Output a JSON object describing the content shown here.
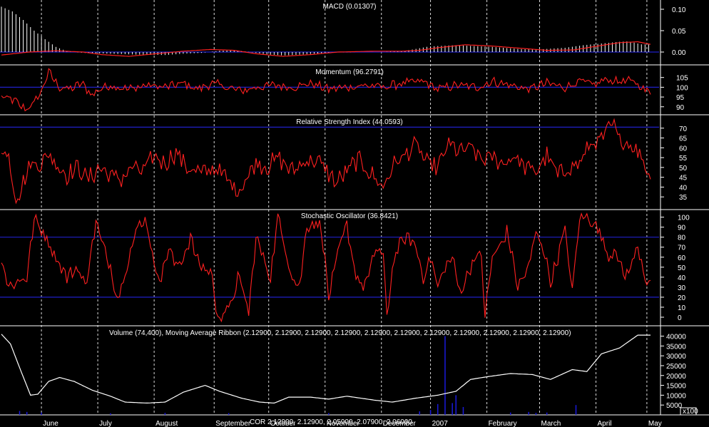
{
  "colors": {
    "background": "#000000",
    "indicator_line": "#ff2020",
    "reference_line": "#2020c8",
    "volume_line": "#ffffff",
    "histogram": "#ffffff",
    "volume_bars": "#1a1adc",
    "month_grid": "#ffffff",
    "text": "#ffffff"
  },
  "ohlc_label": "COR 2.12900, 2.12900, 2.05900, 2.07900, 2.06000",
  "scale_label": "x100",
  "chart_data": [
    {
      "type": "line",
      "panel": "macd",
      "title": "MACD (0.01307)",
      "ylim": [
        -0.015,
        0.115
      ],
      "yticks": [
        "0.10",
        "0.05",
        "0.00"
      ],
      "ytick_values": [
        0.1,
        0.05,
        0.0
      ],
      "reference_lines": [
        0.0
      ],
      "histogram_keys": [
        [
          0,
          0.106
        ],
        [
          6,
          0.095
        ],
        [
          12,
          0.075
        ],
        [
          18,
          0.05
        ],
        [
          24,
          0.03
        ],
        [
          30,
          0.012
        ],
        [
          36,
          0.002
        ],
        [
          45,
          -0.002
        ],
        [
          60,
          -0.004
        ],
        [
          75,
          -0.006
        ],
        [
          90,
          -0.007
        ],
        [
          100,
          -0.004
        ],
        [
          110,
          -0.002
        ],
        [
          120,
          0.003
        ],
        [
          128,
          0.004
        ],
        [
          135,
          0.001
        ],
        [
          145,
          -0.005
        ],
        [
          155,
          -0.008
        ],
        [
          165,
          -0.006
        ],
        [
          175,
          -0.003
        ],
        [
          185,
          -0.001
        ],
        [
          195,
          0.0
        ],
        [
          210,
          0.0
        ],
        [
          220,
          0.002
        ],
        [
          225,
          0.005
        ],
        [
          235,
          0.013
        ],
        [
          250,
          0.016
        ],
        [
          270,
          0.012
        ],
        [
          285,
          0.007
        ],
        [
          295,
          0.006
        ],
        [
          310,
          0.01
        ],
        [
          320,
          0.016
        ],
        [
          330,
          0.02
        ],
        [
          340,
          0.024
        ],
        [
          345,
          0.025
        ],
        [
          352,
          0.018
        ]
      ],
      "signal_keys": [
        [
          0,
          -0.007
        ],
        [
          15,
          0.0
        ],
        [
          30,
          0.003
        ],
        [
          45,
          0.0
        ],
        [
          55,
          -0.006
        ],
        [
          70,
          -0.01
        ],
        [
          85,
          -0.004
        ],
        [
          100,
          0.002
        ],
        [
          115,
          0.006
        ],
        [
          128,
          0.004
        ],
        [
          140,
          -0.004
        ],
        [
          155,
          -0.01
        ],
        [
          170,
          -0.006
        ],
        [
          185,
          0.0
        ],
        [
          205,
          0.002
        ],
        [
          220,
          0.002
        ],
        [
          230,
          0.004
        ],
        [
          240,
          0.01
        ],
        [
          255,
          0.017
        ],
        [
          270,
          0.014
        ],
        [
          285,
          0.009
        ],
        [
          300,
          0.004
        ],
        [
          315,
          0.005
        ],
        [
          325,
          0.012
        ],
        [
          340,
          0.022
        ],
        [
          350,
          0.024
        ],
        [
          357,
          0.018
        ]
      ],
      "n_points": 358
    },
    {
      "type": "line",
      "panel": "momentum",
      "title": "Momentum (96.2791)",
      "ylim": [
        87,
        110
      ],
      "yticks": [
        "105",
        "100",
        "95",
        "90"
      ],
      "ytick_values": [
        105,
        100,
        95,
        90
      ],
      "reference_lines": [
        100
      ],
      "keys": [
        [
          0,
          95
        ],
        [
          8,
          93
        ],
        [
          10,
          90
        ],
        [
          14,
          89
        ],
        [
          18,
          92
        ],
        [
          22,
          98
        ],
        [
          26,
          108
        ],
        [
          28,
          105
        ],
        [
          32,
          100
        ],
        [
          38,
          99
        ],
        [
          44,
          102
        ],
        [
          50,
          96
        ],
        [
          54,
          99
        ],
        [
          60,
          101
        ],
        [
          70,
          99
        ],
        [
          80,
          101
        ],
        [
          90,
          100
        ],
        [
          100,
          102
        ],
        [
          108,
          99
        ],
        [
          116,
          102
        ],
        [
          124,
          100
        ],
        [
          132,
          98
        ],
        [
          140,
          100
        ],
        [
          150,
          101
        ],
        [
          160,
          100
        ],
        [
          170,
          102
        ],
        [
          180,
          99
        ],
        [
          190,
          100
        ],
        [
          200,
          101
        ],
        [
          210,
          100
        ],
        [
          220,
          102
        ],
        [
          232,
          103
        ],
        [
          240,
          99
        ],
        [
          250,
          101
        ],
        [
          262,
          100
        ],
        [
          270,
          103
        ],
        [
          280,
          101
        ],
        [
          290,
          99
        ],
        [
          300,
          102
        ],
        [
          310,
          100
        ],
        [
          318,
          103
        ],
        [
          326,
          101
        ],
        [
          332,
          104
        ],
        [
          340,
          103
        ],
        [
          348,
          103
        ],
        [
          355,
          98
        ],
        [
          357,
          96.3
        ]
      ],
      "noise": 2.0,
      "n_points": 358
    },
    {
      "type": "line",
      "panel": "rsi",
      "title": "Relative Strength Index (44.0593)",
      "ylim": [
        30,
        75
      ],
      "yticks": [
        "70",
        "65",
        "60",
        "55",
        "50",
        "45",
        "40",
        "35"
      ],
      "ytick_values": [
        70,
        65,
        60,
        55,
        50,
        45,
        40,
        35
      ],
      "reference_lines": [
        70.5
      ],
      "keys": [
        [
          0,
          60
        ],
        [
          4,
          55
        ],
        [
          8,
          34
        ],
        [
          12,
          42
        ],
        [
          16,
          52
        ],
        [
          22,
          52
        ],
        [
          26,
          57
        ],
        [
          30,
          52
        ],
        [
          36,
          46
        ],
        [
          42,
          50
        ],
        [
          48,
          44
        ],
        [
          54,
          50
        ],
        [
          60,
          46
        ],
        [
          66,
          44
        ],
        [
          72,
          50
        ],
        [
          78,
          48
        ],
        [
          84,
          56
        ],
        [
          90,
          52
        ],
        [
          96,
          58
        ],
        [
          102,
          50
        ],
        [
          110,
          47
        ],
        [
          118,
          50
        ],
        [
          124,
          44
        ],
        [
          130,
          38
        ],
        [
          136,
          46
        ],
        [
          140,
          53
        ],
        [
          146,
          50
        ],
        [
          152,
          55
        ],
        [
          160,
          48
        ],
        [
          168,
          54
        ],
        [
          176,
          52
        ],
        [
          184,
          42
        ],
        [
          190,
          48
        ],
        [
          196,
          54
        ],
        [
          204,
          46
        ],
        [
          210,
          40
        ],
        [
          216,
          52
        ],
        [
          222,
          56
        ],
        [
          228,
          62
        ],
        [
          234,
          52
        ],
        [
          240,
          50
        ],
        [
          246,
          62
        ],
        [
          252,
          58
        ],
        [
          258,
          60
        ],
        [
          264,
          54
        ],
        [
          270,
          55
        ],
        [
          276,
          52
        ],
        [
          282,
          56
        ],
        [
          288,
          50
        ],
        [
          294,
          48
        ],
        [
          300,
          56
        ],
        [
          306,
          46
        ],
        [
          312,
          50
        ],
        [
          318,
          52
        ],
        [
          324,
          62
        ],
        [
          330,
          64
        ],
        [
          336,
          72
        ],
        [
          340,
          64
        ],
        [
          346,
          62
        ],
        [
          352,
          56
        ],
        [
          357,
          44
        ]
      ],
      "noise": 4.0,
      "n_points": 358
    },
    {
      "type": "line",
      "panel": "stochastic",
      "title": "Stochastic Oscillator (36.8421)",
      "ylim": [
        -5,
        104
      ],
      "yticks": [
        "100",
        "90",
        "80",
        "70",
        "60",
        "50",
        "40",
        "30",
        "20",
        "10",
        "0"
      ],
      "ytick_values": [
        100,
        90,
        80,
        70,
        60,
        50,
        40,
        30,
        20,
        10,
        0
      ],
      "reference_lines": [
        80,
        20
      ],
      "keys": [
        [
          0,
          60
        ],
        [
          4,
          30
        ],
        [
          8,
          35
        ],
        [
          14,
          40
        ],
        [
          18,
          98
        ],
        [
          24,
          82
        ],
        [
          30,
          60
        ],
        [
          36,
          40
        ],
        [
          42,
          50
        ],
        [
          46,
          30
        ],
        [
          52,
          95
        ],
        [
          56,
          70
        ],
        [
          60,
          50
        ],
        [
          64,
          18
        ],
        [
          70,
          60
        ],
        [
          76,
          95
        ],
        [
          80,
          96
        ],
        [
          84,
          50
        ],
        [
          88,
          40
        ],
        [
          92,
          70
        ],
        [
          96,
          50
        ],
        [
          100,
          60
        ],
        [
          104,
          80
        ],
        [
          108,
          55
        ],
        [
          112,
          48
        ],
        [
          116,
          44
        ],
        [
          118,
          2
        ],
        [
          122,
          4
        ],
        [
          126,
          10
        ],
        [
          130,
          40
        ],
        [
          134,
          20
        ],
        [
          136,
          4
        ],
        [
          140,
          80
        ],
        [
          144,
          60
        ],
        [
          148,
          40
        ],
        [
          152,
          100
        ],
        [
          156,
          70
        ],
        [
          160,
          40
        ],
        [
          164,
          30
        ],
        [
          168,
          92
        ],
        [
          172,
          94
        ],
        [
          176,
          90
        ],
        [
          180,
          20
        ],
        [
          186,
          70
        ],
        [
          190,
          92
        ],
        [
          194,
          50
        ],
        [
          198,
          30
        ],
        [
          202,
          40
        ],
        [
          206,
          70
        ],
        [
          210,
          60
        ],
        [
          212,
          2
        ],
        [
          216,
          60
        ],
        [
          220,
          75
        ],
        [
          224,
          80
        ],
        [
          228,
          70
        ],
        [
          232,
          40
        ],
        [
          236,
          60
        ],
        [
          240,
          30
        ],
        [
          244,
          50
        ],
        [
          248,
          60
        ],
        [
          252,
          25
        ],
        [
          256,
          40
        ],
        [
          260,
          60
        ],
        [
          264,
          60
        ],
        [
          266,
          2
        ],
        [
          270,
          60
        ],
        [
          274,
          70
        ],
        [
          278,
          85
        ],
        [
          280,
          70
        ],
        [
          284,
          30
        ],
        [
          290,
          50
        ],
        [
          294,
          85
        ],
        [
          298,
          70
        ],
        [
          302,
          35
        ],
        [
          306,
          60
        ],
        [
          310,
          88
        ],
        [
          314,
          25
        ],
        [
          318,
          100
        ],
        [
          322,
          100
        ],
        [
          326,
          95
        ],
        [
          330,
          80
        ],
        [
          334,
          60
        ],
        [
          338,
          70
        ],
        [
          342,
          40
        ],
        [
          346,
          50
        ],
        [
          350,
          70
        ],
        [
          355,
          35
        ],
        [
          357,
          36.8
        ]
      ],
      "noise": 6.0,
      "n_points": 358
    },
    {
      "type": "line",
      "panel": "volume",
      "title": "Volume (74,400), Moving Average Ribbon (2.12900, 2.12900, 2.12900, 2.12900, 2.12900, 2.12900, 2.12900, 2.12900, 2.12900, 2.12900, 2.12900)",
      "ylim": [
        0,
        42000
      ],
      "yticks": [
        "40000",
        "35000",
        "30000",
        "25000",
        "20000",
        "15000",
        "10000",
        "5000"
      ],
      "ytick_values": [
        40000,
        35000,
        30000,
        25000,
        20000,
        15000,
        10000,
        5000
      ],
      "ma_keys": [
        [
          0,
          41000
        ],
        [
          5,
          36000
        ],
        [
          10,
          24000
        ],
        [
          16,
          10000
        ],
        [
          20,
          10500
        ],
        [
          26,
          17000
        ],
        [
          32,
          19000
        ],
        [
          40,
          17000
        ],
        [
          50,
          12500
        ],
        [
          60,
          9500
        ],
        [
          68,
          6500
        ],
        [
          80,
          6000
        ],
        [
          90,
          6500
        ],
        [
          100,
          11500
        ],
        [
          112,
          15000
        ],
        [
          120,
          12000
        ],
        [
          132,
          8500
        ],
        [
          142,
          6500
        ],
        [
          150,
          6000
        ],
        [
          158,
          9000
        ],
        [
          170,
          9000
        ],
        [
          180,
          8000
        ],
        [
          190,
          9500
        ],
        [
          205,
          7500
        ],
        [
          215,
          6500
        ],
        [
          228,
          8500
        ],
        [
          240,
          10000
        ],
        [
          250,
          12000
        ],
        [
          258,
          18000
        ],
        [
          268,
          19500
        ],
        [
          280,
          21000
        ],
        [
          292,
          20500
        ],
        [
          302,
          18000
        ],
        [
          314,
          23000
        ],
        [
          322,
          22000
        ],
        [
          330,
          31000
        ],
        [
          340,
          34000
        ],
        [
          350,
          40500
        ],
        [
          357,
          40500
        ]
      ],
      "bars": [
        [
          10,
          2000
        ],
        [
          14,
          1500
        ],
        [
          22,
          1200
        ],
        [
          60,
          800
        ],
        [
          90,
          1000
        ],
        [
          125,
          900
        ],
        [
          180,
          900
        ],
        [
          230,
          1800
        ],
        [
          236,
          2500
        ],
        [
          240,
          5500
        ],
        [
          244,
          40000
        ],
        [
          248,
          6000
        ],
        [
          250,
          10000
        ],
        [
          254,
          4000
        ],
        [
          280,
          1200
        ],
        [
          290,
          1500
        ],
        [
          294,
          1000
        ],
        [
          300,
          1200
        ],
        [
          316,
          5000
        ]
      ],
      "n_points": 358
    }
  ],
  "x_axis": {
    "months": [
      {
        "label": "June",
        "idx": 22
      },
      {
        "label": "July",
        "idx": 53
      },
      {
        "label": "August",
        "idx": 84
      },
      {
        "label": "September",
        "idx": 117
      },
      {
        "label": "October",
        "idx": 147
      },
      {
        "label": "November",
        "idx": 178
      },
      {
        "label": "December",
        "idx": 209
      },
      {
        "label": "2007",
        "idx": 236
      },
      {
        "label": "February",
        "idx": 267
      },
      {
        "label": "March",
        "idx": 296
      },
      {
        "label": "April",
        "idx": 327
      },
      {
        "label": "May",
        "idx": 355
      }
    ]
  }
}
